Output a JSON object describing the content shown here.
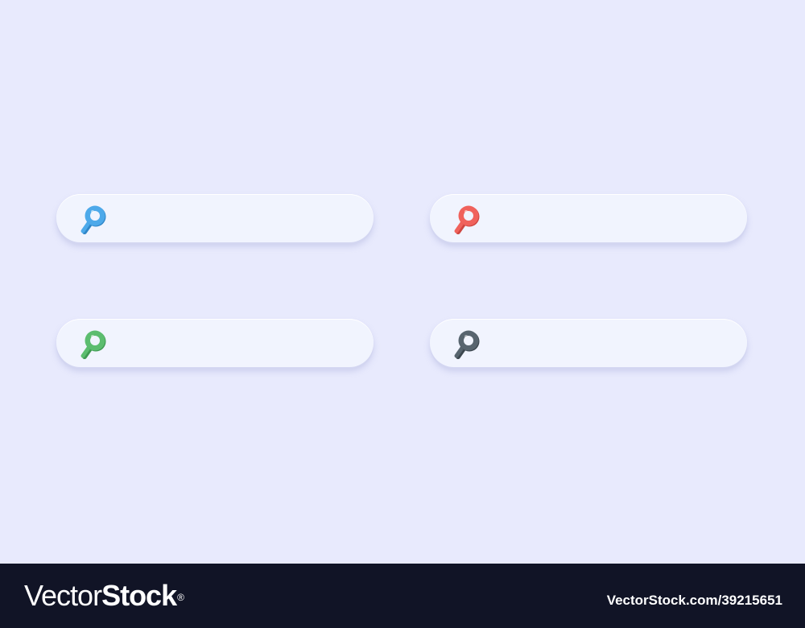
{
  "search_bars": [
    {
      "id": "search-bar-blue",
      "icon": "search-icon",
      "icon_color": "#4da9ea",
      "icon_shadow": "#2f86c8",
      "value": "",
      "placeholder": ""
    },
    {
      "id": "search-bar-red",
      "icon": "search-icon",
      "icon_color": "#f0625c",
      "icon_shadow": "#cf4540",
      "value": "",
      "placeholder": ""
    },
    {
      "id": "search-bar-green",
      "icon": "search-icon",
      "icon_color": "#5cbd6f",
      "icon_shadow": "#3f9a52",
      "value": "",
      "placeholder": ""
    },
    {
      "id": "search-bar-dark",
      "icon": "search-icon",
      "icon_color": "#58656f",
      "icon_shadow": "#3c474f",
      "value": "",
      "placeholder": ""
    }
  ],
  "colors": {
    "background": "#e8eafd",
    "bar_fill": "#f1f4fe",
    "footer": "#111426"
  },
  "footer": {
    "brand_light": "Vector",
    "brand_bold": "Stock",
    "brand_mark": "®",
    "asset_id": "VectorStock.com/39215651"
  }
}
